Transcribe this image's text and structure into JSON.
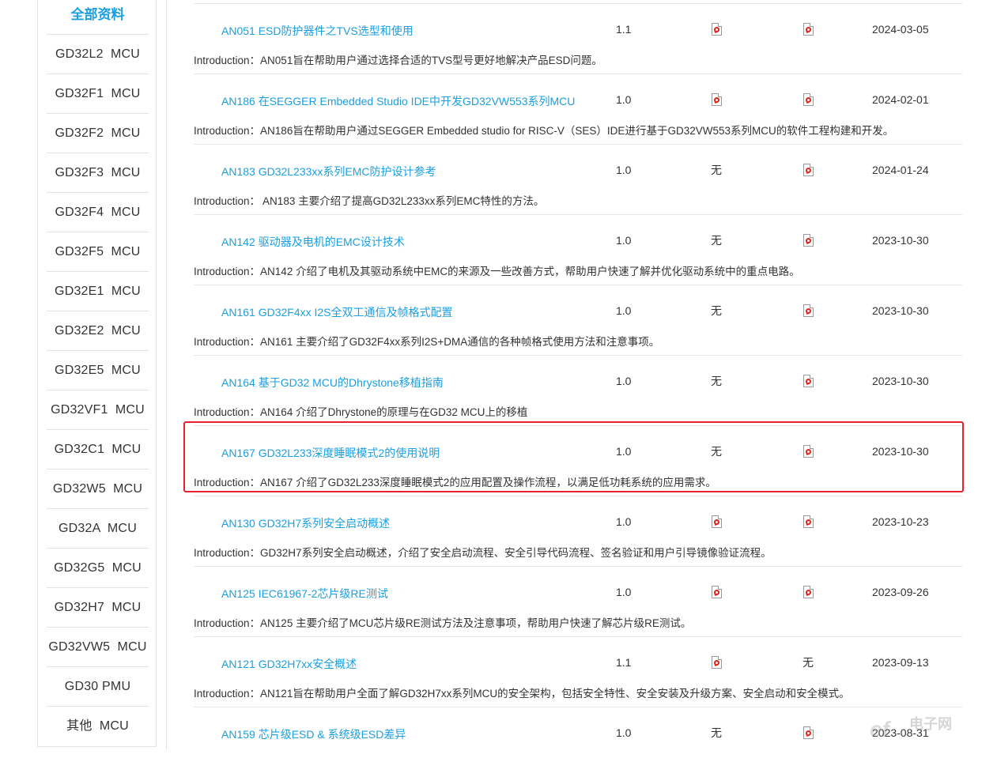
{
  "sidebar": {
    "title": "全部资料",
    "items": [
      "GD32L2  MCU",
      "GD32F1  MCU",
      "GD32F2  MCU",
      "GD32F3  MCU",
      "GD32F4  MCU",
      "GD32F5  MCU",
      "GD32E1  MCU",
      "GD32E2  MCU",
      "GD32E5  MCU",
      "GD32VF1  MCU",
      "GD32C1  MCU",
      "GD32W5  MCU",
      "GD32A  MCU",
      "GD32G5  MCU",
      "GD32H7  MCU",
      "GD32VW5  MCU",
      "GD30 PMU",
      "其他  MCU"
    ]
  },
  "labels": {
    "none": "无",
    "pdf_icon": "pdf-icon"
  },
  "documents": [
    {
      "title": "AN051 ESD防护器件之TVS选型和使用",
      "version": "1.1",
      "col1": "pdf",
      "col2": "pdf",
      "date": "2024-03-05",
      "intro": "Introduction：AN051旨在帮助用户通过选择合适的TVS型号更好地解决产品ESD问题。"
    },
    {
      "title": "AN186 在SEGGER Embedded Studio IDE中开发GD32VW553系列MCU",
      "version": "1.0",
      "col1": "pdf",
      "col2": "pdf",
      "date": "2024-02-01",
      "intro": "Introduction：AN186旨在帮助用户通过SEGGER Embedded studio for RISC-V（SES）IDE进行基于GD32VW553系列MCU的软件工程构建和开发。"
    },
    {
      "title": "AN183 GD32L233xx系列EMC防护设计参考",
      "version": "1.0",
      "col1": "无",
      "col2": "pdf",
      "date": "2024-01-24",
      "intro": "Introduction： AN183 主要介绍了提高GD32L233xx系列EMC特性的方法。"
    },
    {
      "title": "AN142 驱动器及电机的EMC设计技术",
      "version": "1.0",
      "col1": "无",
      "col2": "pdf",
      "date": "2023-10-30",
      "intro": "Introduction：AN142 介绍了电机及其驱动系统中EMC的来源及一些改善方式，帮助用户快速了解并优化驱动系统中的重点电路。"
    },
    {
      "title": "AN161 GD32F4xx I2S全双工通信及帧格式配置",
      "version": "1.0",
      "col1": "无",
      "col2": "pdf",
      "date": "2023-10-30",
      "intro": "Introduction：AN161 主要介绍了GD32F4xx系列I2S+DMA通信的各种帧格式使用方法和注意事项。"
    },
    {
      "title": "AN164 基于GD32 MCU的Dhrystone移植指南",
      "version": "1.0",
      "col1": "无",
      "col2": "pdf",
      "date": "2023-10-30",
      "intro": "Introduction：AN164 介绍了Dhrystone的原理与在GD32 MCU上的移植"
    },
    {
      "title": "AN167 GD32L233深度睡眠模式2的使用说明",
      "version": "1.0",
      "col1": "无",
      "col2": "pdf",
      "date": "2023-10-30",
      "intro": "Introduction：AN167 介绍了GD32L233深度睡眠模式2的应用配置及操作流程，以满足低功耗系统的应用需求。"
    },
    {
      "title": "AN130 GD32H7系列安全启动概述",
      "version": "1.0",
      "col1": "pdf",
      "col2": "pdf",
      "date": "2023-10-23",
      "intro": "Introduction：GD32H7系列安全启动概述，介绍了安全启动流程、安全引导代码流程、签名验证和用户引导镜像验证流程。"
    },
    {
      "title": "AN125 IEC61967-2芯片级RE测试",
      "version": "1.0",
      "col1": "pdf",
      "col2": "pdf",
      "date": "2023-09-26",
      "intro": "Introduction：AN125 主要介绍了MCU芯片级RE测试方法及注意事项，帮助用户快速了解芯片级RE测试。"
    },
    {
      "title": "AN121 GD32H7xx安全概述",
      "version": "1.1",
      "col1": "pdf",
      "col2": "无",
      "date": "2023-09-13",
      "intro": "Introduction：AN121旨在帮助用户全面了解GD32H7xx系列MCU的安全架构，包括安全特性、安全安装及升级方案、安全启动和安全模式。"
    },
    {
      "title": "AN159 芯片级ESD & 系统级ESD差异",
      "version": "1.0",
      "col1": "无",
      "col2": "pdf",
      "date": "2023-08-31",
      "intro": ""
    }
  ],
  "highlight_row": 6,
  "colors": {
    "accent": "#1a9fe0",
    "highlight": "#e2232a",
    "pdf_red": "#d9251c"
  },
  "watermark": {
    "logo": "elecfans",
    "text": "电子网"
  }
}
